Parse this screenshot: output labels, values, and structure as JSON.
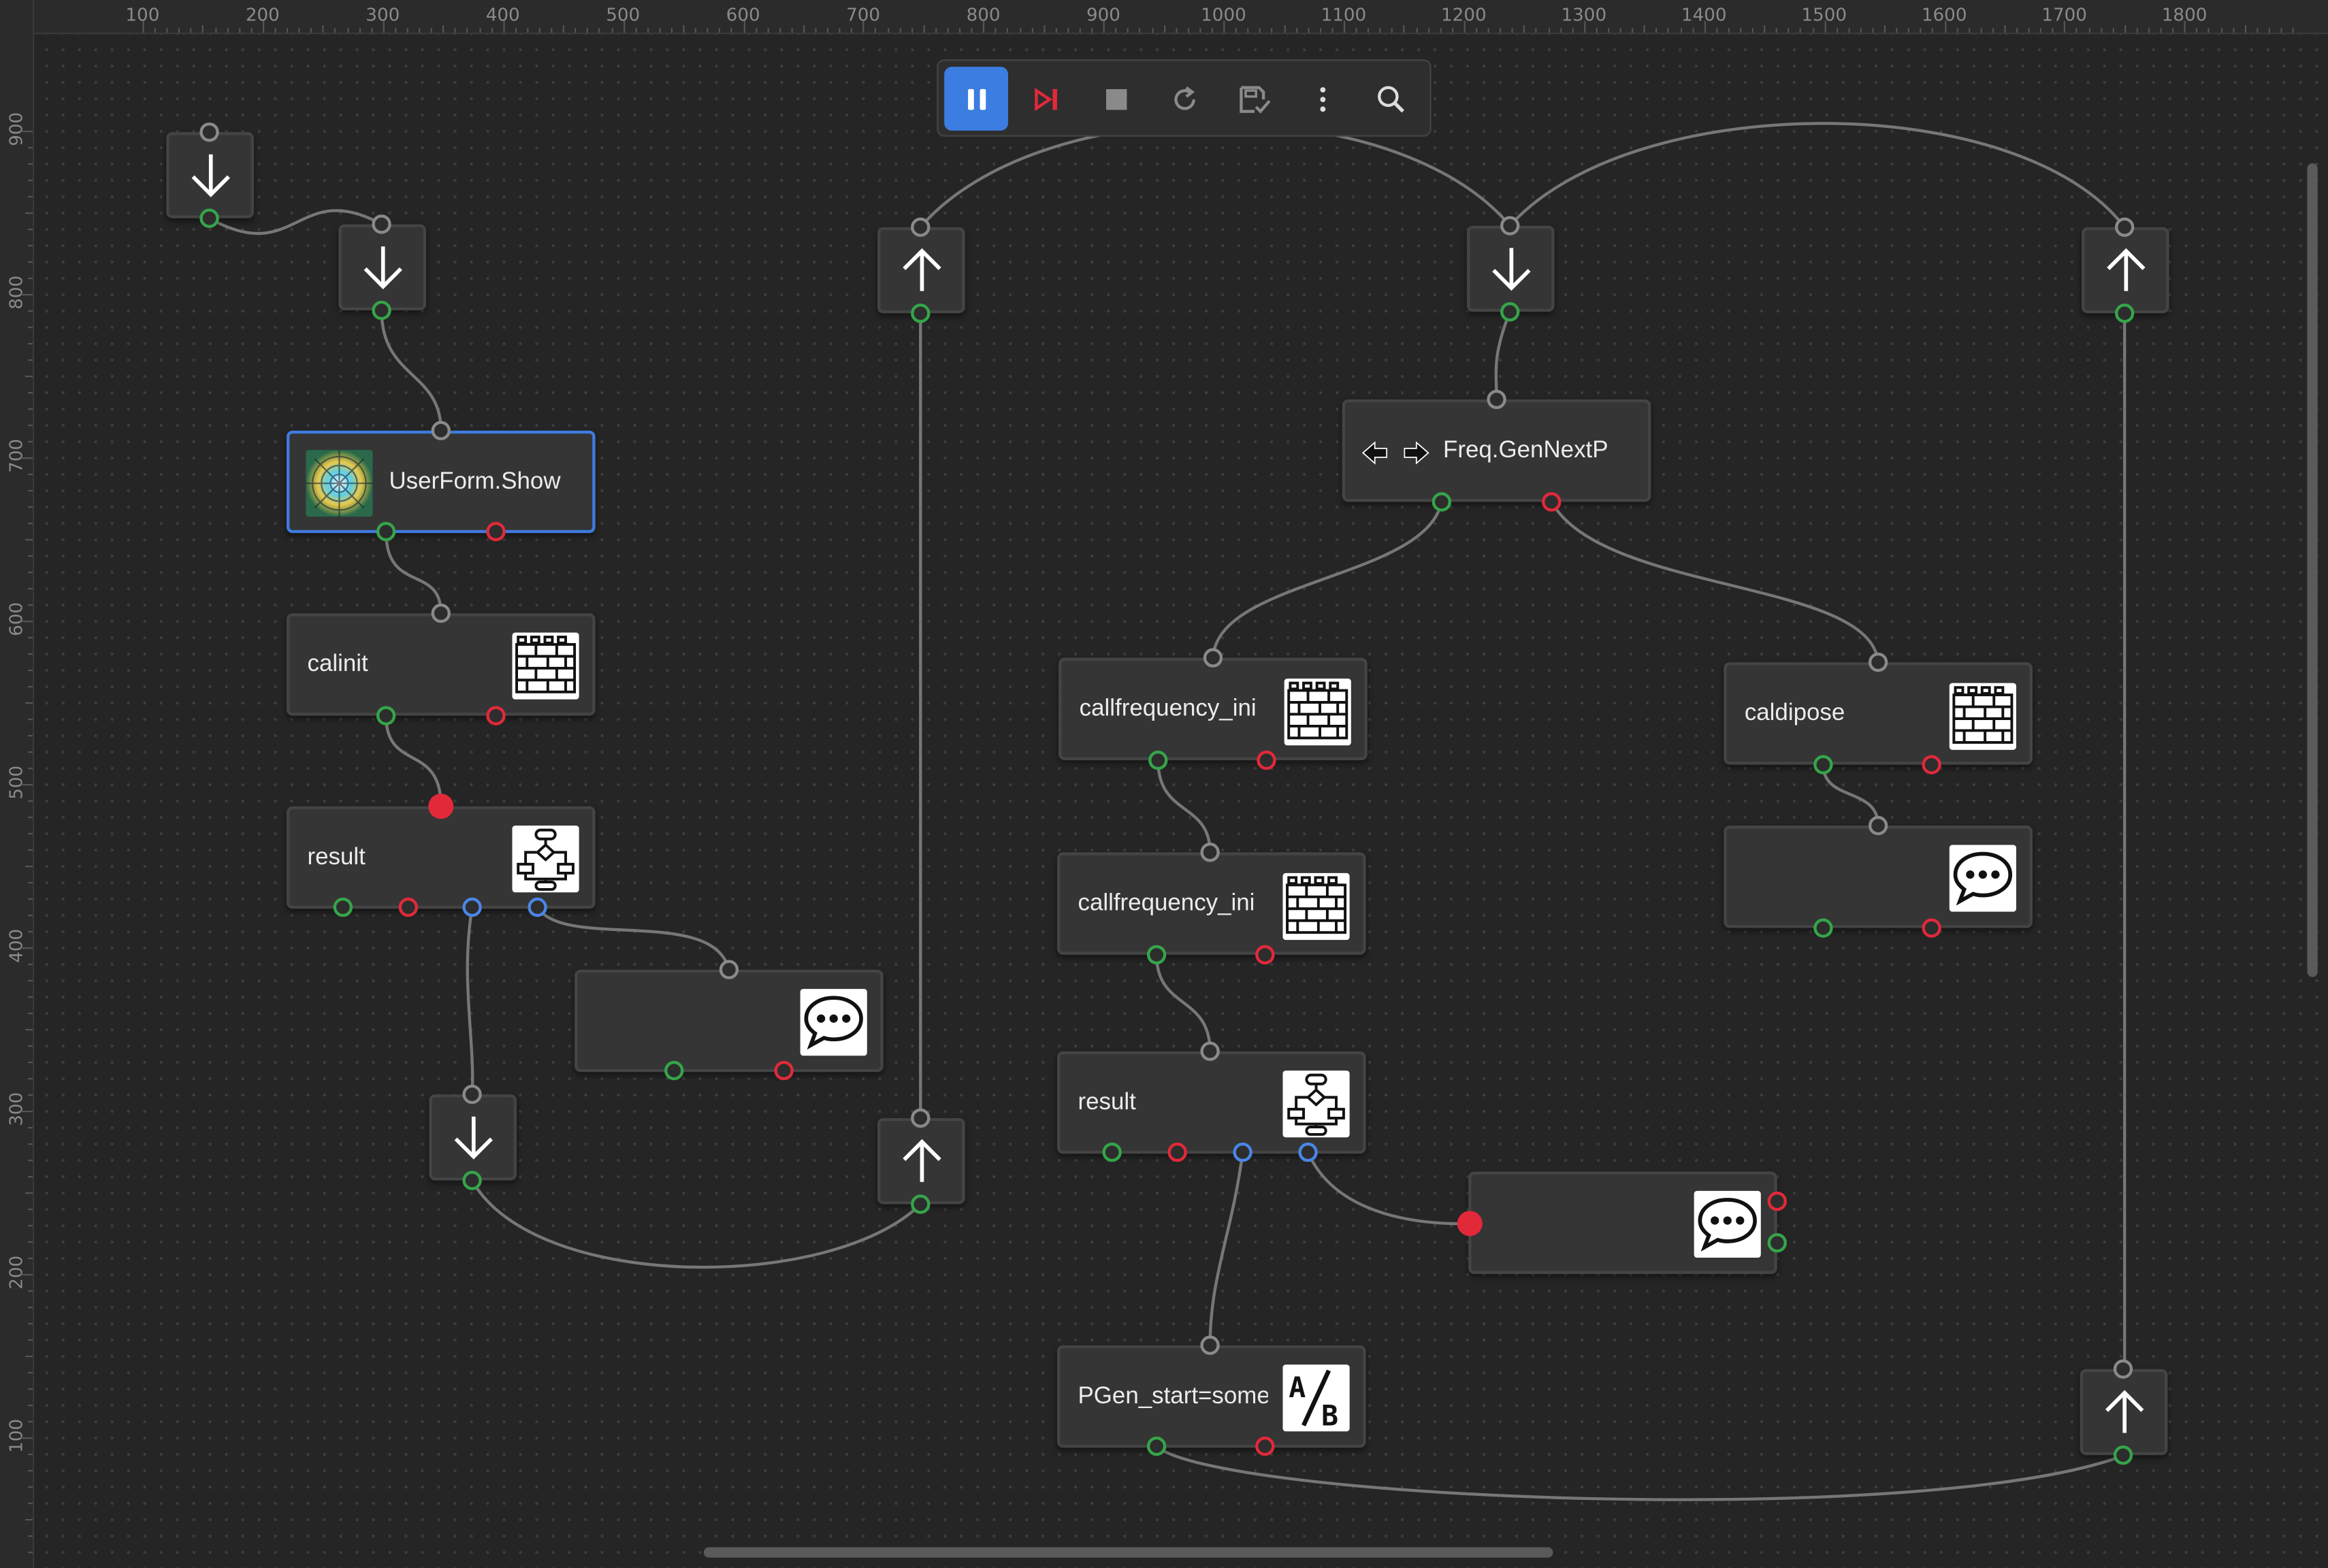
{
  "ruler": {
    "x_ticks": [
      "100",
      "200",
      "300",
      "400",
      "500",
      "600",
      "700",
      "800",
      "900",
      "1000",
      "1100",
      "1200",
      "1300",
      "1400",
      "1500",
      "1600",
      "1700",
      "1800"
    ],
    "y_ticks": [
      "900",
      "800",
      "700",
      "600",
      "500",
      "400",
      "300",
      "200",
      "100"
    ]
  },
  "toolbar": {
    "buttons": [
      {
        "name": "pause",
        "icon": "pause-icon",
        "active": true
      },
      {
        "name": "step",
        "icon": "step-forward-icon"
      },
      {
        "name": "stop",
        "icon": "stop-icon"
      },
      {
        "name": "restart",
        "icon": "restart-icon"
      },
      {
        "name": "save-check",
        "icon": "save-check-icon"
      },
      {
        "name": "more",
        "icon": "more-vertical-icon"
      },
      {
        "name": "search",
        "icon": "search-icon"
      }
    ]
  },
  "nodes": {
    "userform": {
      "label": "UserForm.Show",
      "icon": "mandala-image-icon"
    },
    "calinit": {
      "label": "calinit",
      "icon": "brick-wall-icon"
    },
    "result1": {
      "label": "result",
      "icon": "flowchart-icon"
    },
    "message1": {
      "label": "",
      "icon": "speech-bubble-icon"
    },
    "freq": {
      "label": "Freq.GenNextP",
      "icon": "swap-arrows-icon"
    },
    "callfreq1": {
      "label": "callfrequency_ini",
      "icon": "brick-wall-icon"
    },
    "callfreq2": {
      "label": "callfrequency_ini",
      "icon": "brick-wall-icon"
    },
    "result2": {
      "label": "result",
      "icon": "flowchart-icon"
    },
    "message2": {
      "label": "",
      "icon": "speech-bubble-icon"
    },
    "pgen": {
      "label": "PGen_start=some",
      "icon": "a-over-b-icon"
    },
    "caldipose": {
      "label": "caldipose",
      "icon": "brick-wall-icon"
    },
    "message3": {
      "label": "",
      "icon": "speech-bubble-icon"
    }
  },
  "colors": {
    "accent": "#3b7de0",
    "port_success": "#35a54a",
    "port_error": "#e2293a",
    "port_branch": "#4a86e8",
    "wire": "#7a7a7a",
    "step_icon": "#e2293a"
  }
}
